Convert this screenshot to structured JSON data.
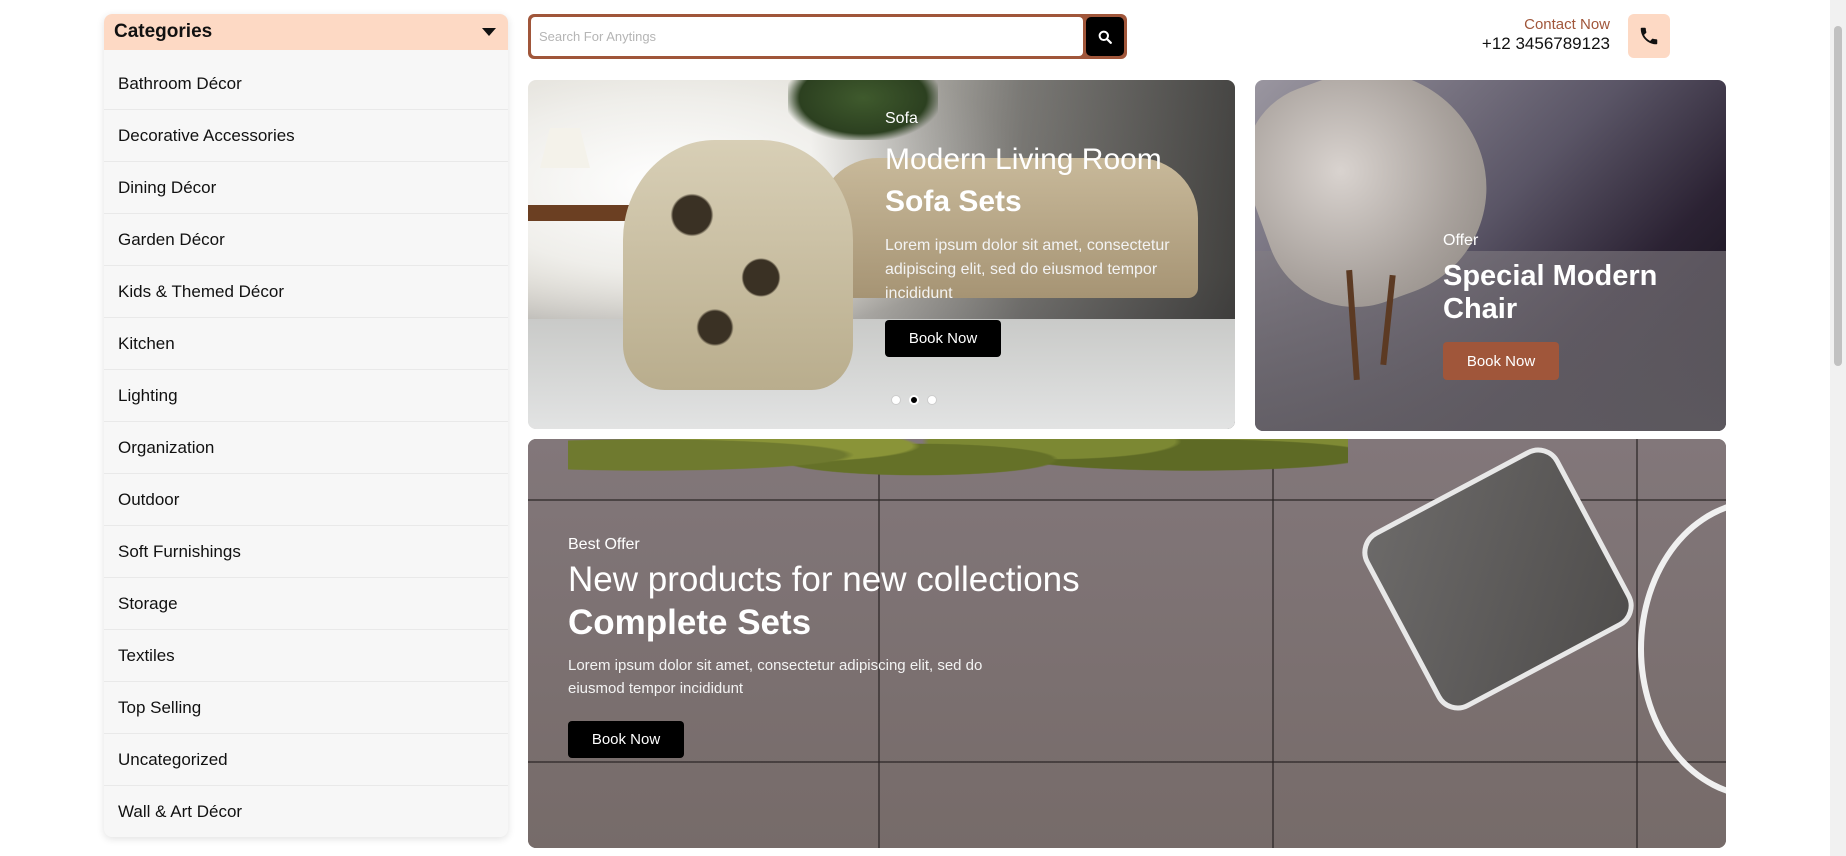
{
  "sidebar": {
    "title": "Categories",
    "items": [
      {
        "label": "Bathroom Décor"
      },
      {
        "label": "Decorative Accessories"
      },
      {
        "label": "Dining Décor"
      },
      {
        "label": "Garden Décor"
      },
      {
        "label": "Kids & Themed Décor"
      },
      {
        "label": "Kitchen"
      },
      {
        "label": "Lighting"
      },
      {
        "label": "Organization"
      },
      {
        "label": "Outdoor"
      },
      {
        "label": "Soft Furnishings"
      },
      {
        "label": "Storage"
      },
      {
        "label": "Textiles"
      },
      {
        "label": "Top Selling"
      },
      {
        "label": "Uncategorized"
      },
      {
        "label": "Wall & Art Décor"
      }
    ]
  },
  "search": {
    "placeholder": "Search For Anytings",
    "icon": "search-icon"
  },
  "contact": {
    "label": "Contact Now",
    "phone": "+12 3456789123",
    "icon": "phone-icon"
  },
  "hero_main": {
    "tag": "Sofa",
    "title_line1": "Modern Living Room",
    "title_line2": "Sofa Sets",
    "description": "Lorem ipsum dolor sit amet, consectetur adipiscing elit, sed do eiusmod tempor incididunt",
    "button": "Book Now",
    "slides": 3,
    "active_slide": 2
  },
  "hero_side": {
    "tag": "Offer",
    "title": "Special Modern Chair",
    "button": "Book Now"
  },
  "hero_bottom": {
    "tag": "Best Offer",
    "title_line1": "New products for new collections",
    "title_line2": "Complete Sets",
    "description": "Lorem ipsum dolor sit amet, consectetur adipiscing elit, sed do eiusmod tempor incididunt",
    "button": "Book Now"
  },
  "colors": {
    "accent_brown": "#a0563a",
    "accent_peach": "#fdd9c4",
    "black": "#000000"
  }
}
